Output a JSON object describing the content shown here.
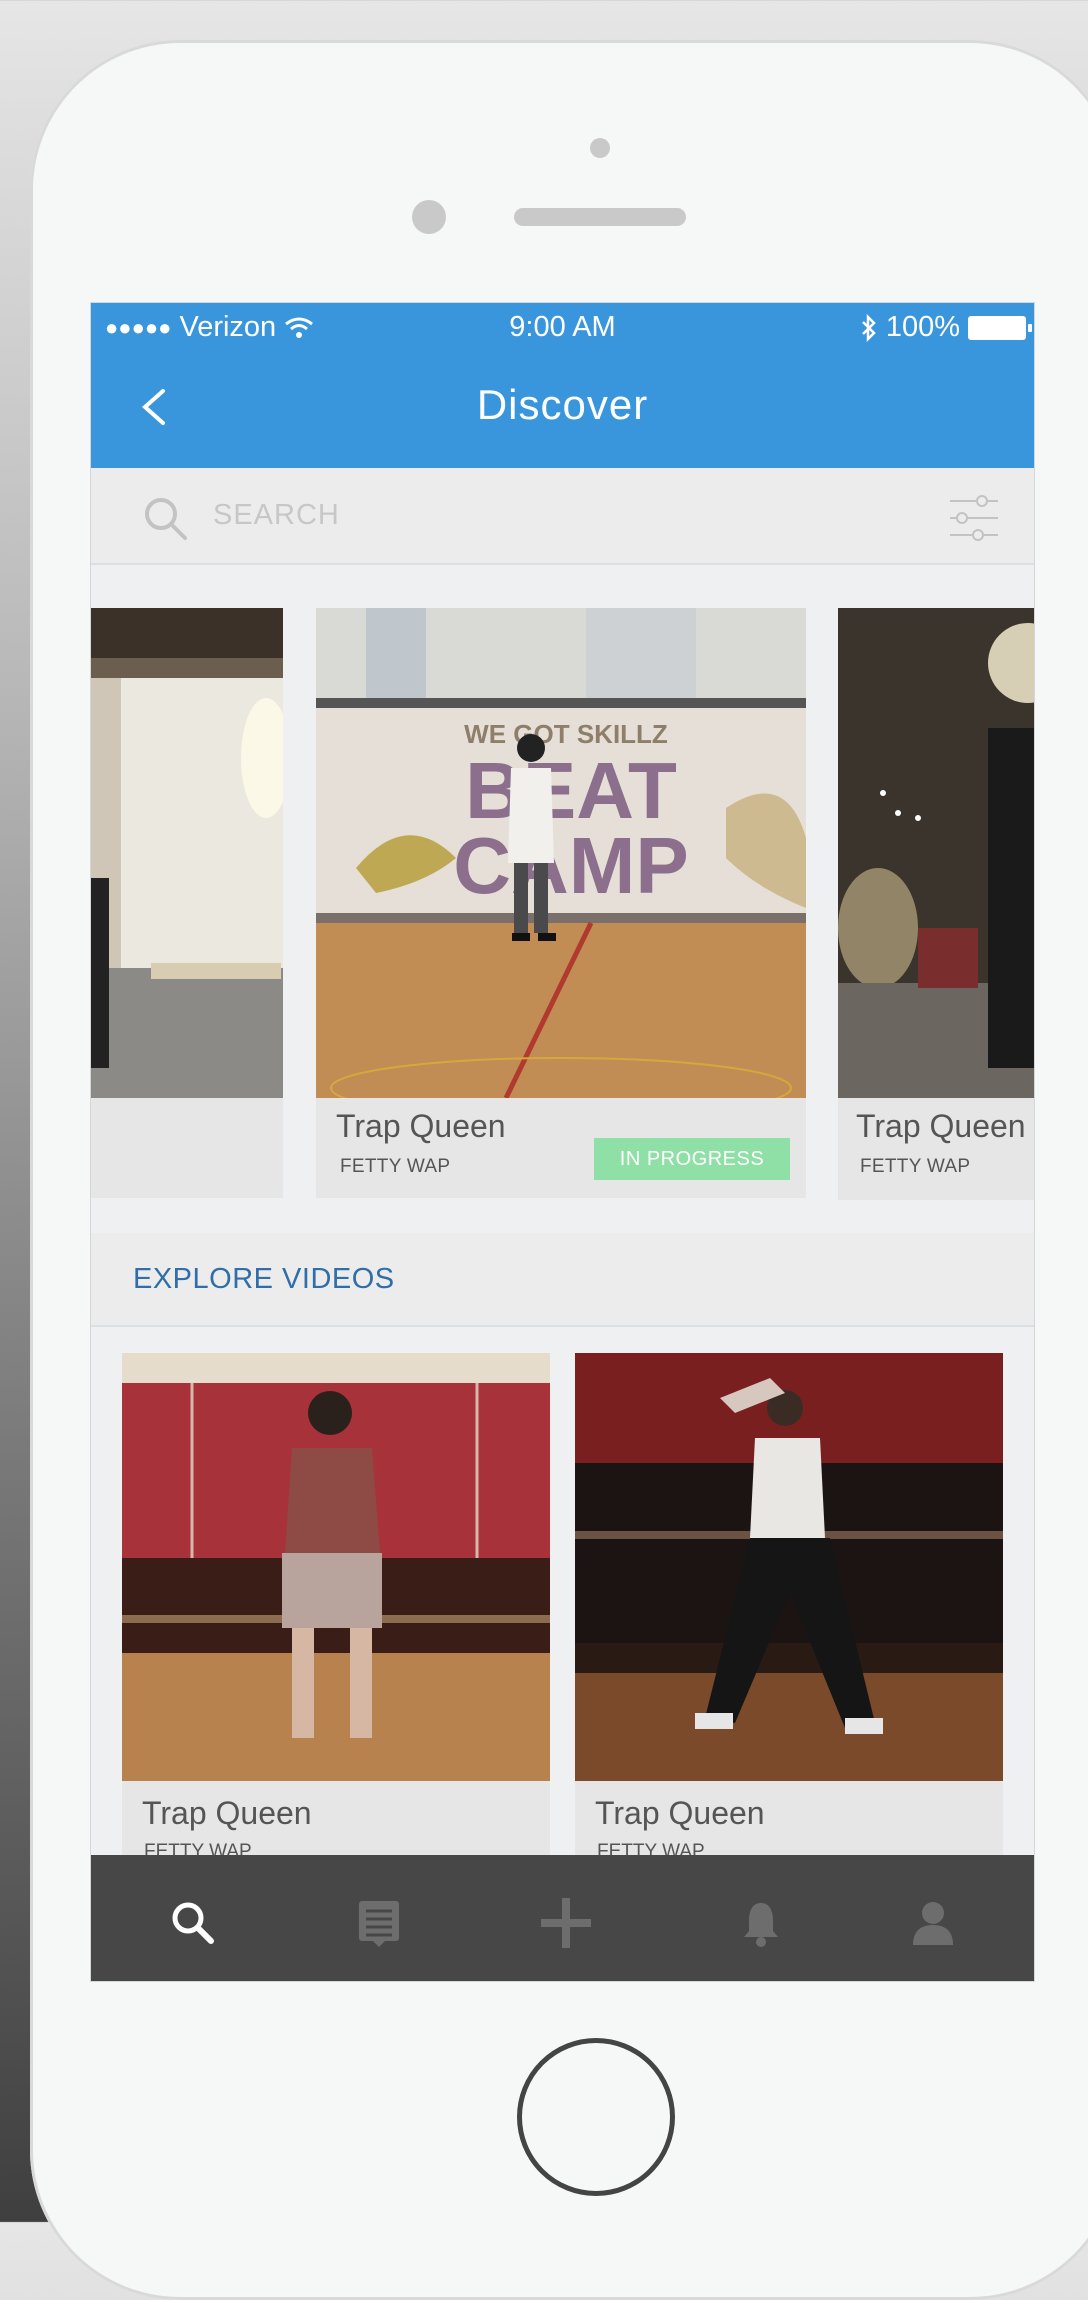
{
  "status_bar": {
    "signal_dots": "●●●●●",
    "carrier": "Verizon",
    "time": "9:00 AM",
    "battery": "100%"
  },
  "nav": {
    "title": "Discover"
  },
  "search": {
    "placeholder": "SEARCH"
  },
  "carousel": {
    "items": [
      {
        "title": "",
        "artist": ""
      },
      {
        "title": "Trap Queen",
        "artist": "FETTY WAP",
        "badge": "IN PROGRESS"
      },
      {
        "title": "Trap Queen",
        "artist": "FETTY WAP"
      }
    ]
  },
  "explore": {
    "title": "EXPLORE VIDEOS",
    "items": [
      {
        "title": "Trap Queen",
        "artist": "FETTY WAP"
      },
      {
        "title": "Trap Queen",
        "artist": "FETTY WAP"
      }
    ]
  },
  "banner_text": {
    "line1": "WE GOT SKILLZ",
    "line2": "BEAT",
    "line3": "CAMP"
  },
  "tabs": [
    {
      "icon": "search-icon",
      "active": true
    },
    {
      "icon": "feed-icon",
      "active": false
    },
    {
      "icon": "plus-icon",
      "active": false
    },
    {
      "icon": "bell-icon",
      "active": false
    },
    {
      "icon": "user-icon",
      "active": false
    }
  ],
  "colors": {
    "nav_blue": "#3a96dc",
    "badge_green": "#8fe0a6",
    "section_title_blue": "#2f6ea8",
    "tabbar_dark": "#474747"
  }
}
